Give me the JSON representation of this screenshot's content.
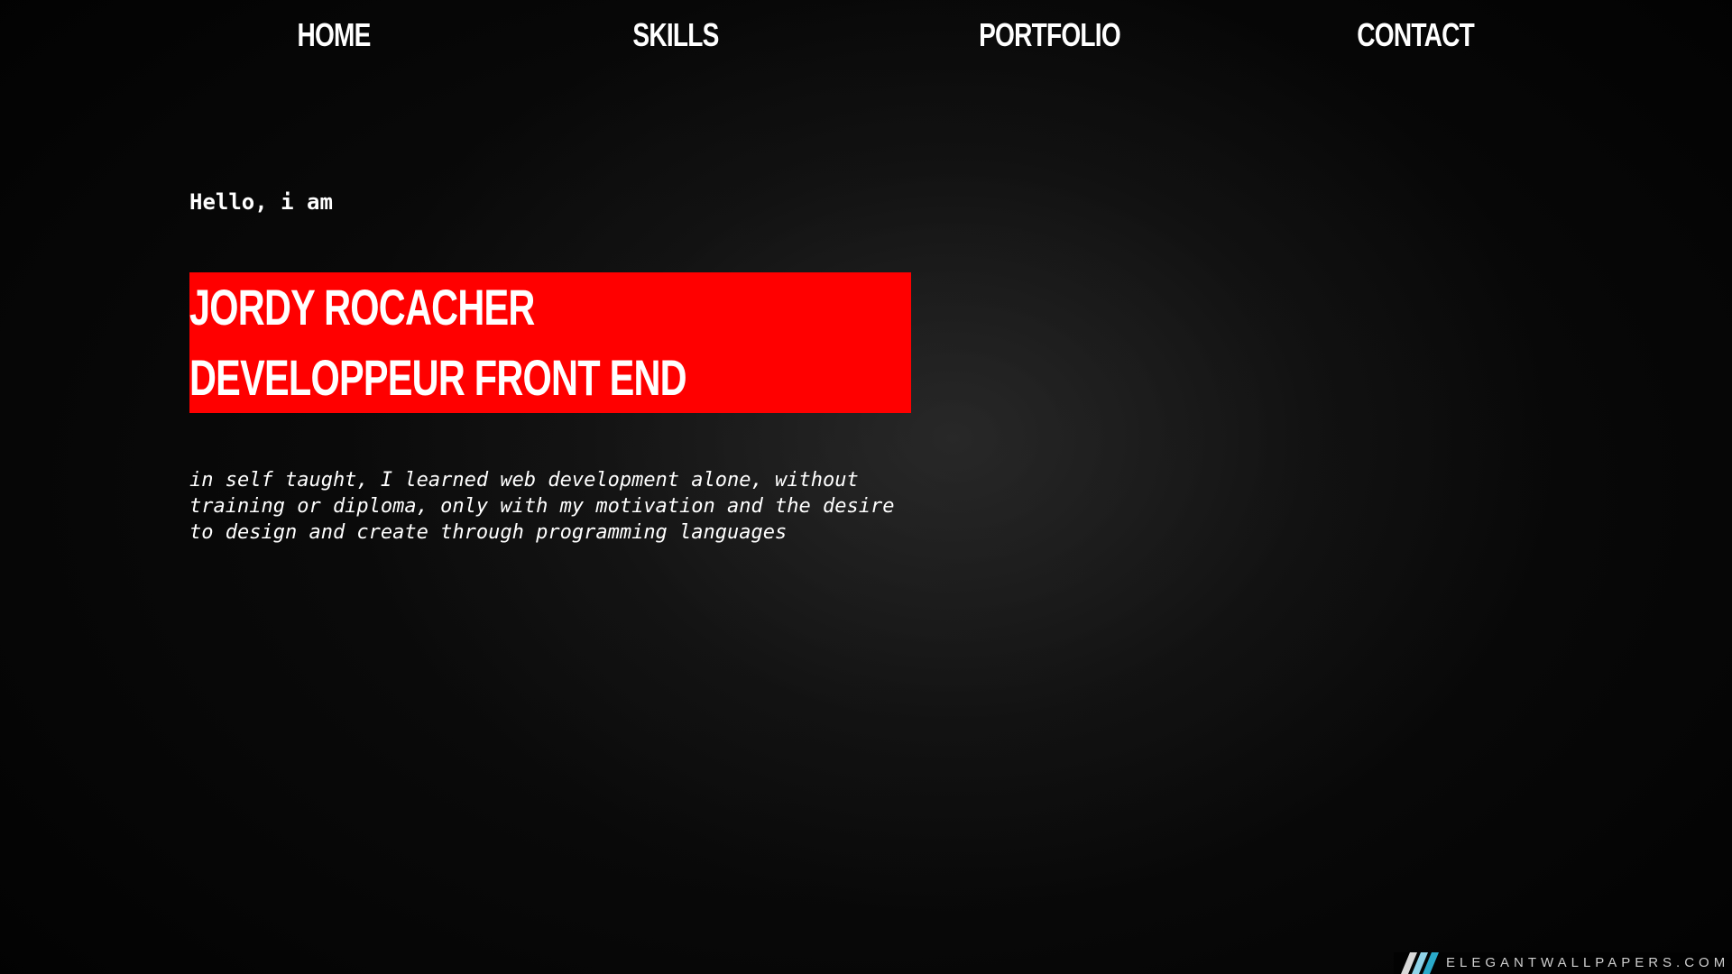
{
  "nav": {
    "items": [
      {
        "label": "HOME"
      },
      {
        "label": "SKILLS"
      },
      {
        "label": "PORTFOLIO"
      },
      {
        "label": "CONTACT"
      }
    ]
  },
  "intro": {
    "greeting": "Hello, i am",
    "name": "JORDY ROCACHER",
    "role": "DEVELOPPEUR FRONT END",
    "bio_lines": [
      "in self taught, I learned web development alone, without",
      "training or diploma, only with my motivation and the desire",
      "to design and create through programming languages"
    ]
  },
  "watermark": {
    "text": "ELEGANTWALLPAPERS.COM"
  },
  "colors": {
    "background": "#0b0b0b",
    "highlight": "#ff0000",
    "text": "#ffffff"
  }
}
